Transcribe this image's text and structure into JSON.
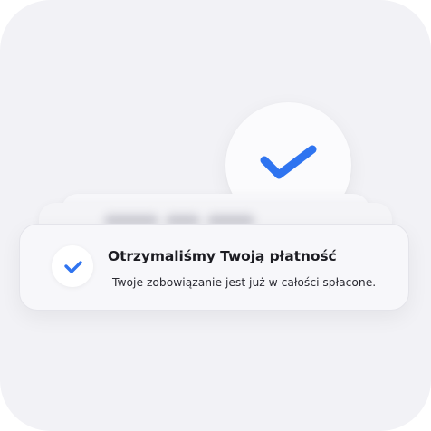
{
  "colors": {
    "accent": "#2f74f0",
    "background": "#f2f2f6",
    "card": "#f7f7fa"
  },
  "status_icon": {
    "icon": "checkmark-icon"
  },
  "notification": {
    "icon": "checkmark-icon",
    "title": "Otrzymaliśmy Twoją płatność",
    "body": "Twoje zobowiązanie jest już w całości spłacone."
  }
}
